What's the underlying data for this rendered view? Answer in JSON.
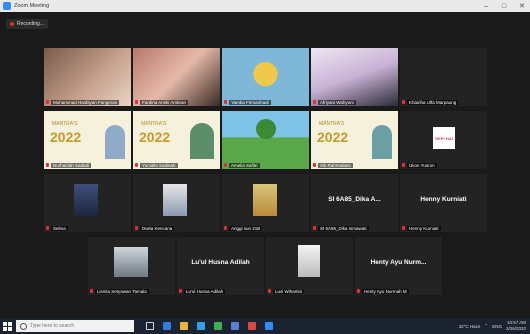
{
  "window": {
    "title": "Zoom Meeting",
    "minimize": "–",
    "maximize": "□",
    "close": "✕"
  },
  "recording": {
    "label": "Recording..."
  },
  "participants": [
    {
      "name": "Muhammad Hasbiyan Fangeran"
    },
    {
      "name": "Fardina Amiki Ambran"
    },
    {
      "name": "Yamba Firmanhadi"
    },
    {
      "name": "Afriyani Wahyuni"
    },
    {
      "name": "Khairiha Ulfa Marpaung"
    },
    {
      "name": "Nurhaidah Sadadi"
    },
    {
      "name": "Yunialla Sadinah"
    },
    {
      "name": "Amelia Safitri"
    },
    {
      "name": "Siti Rahmadani"
    },
    {
      "name": "Ukon Yusron"
    },
    {
      "name": "Selma"
    },
    {
      "name": "Dwita Kencana"
    },
    {
      "name": "Anggi sun 21B"
    },
    {
      "name": "SI 6A85_Dika Ismawati",
      "display": "SI 6A85_Dika A..."
    },
    {
      "name": "Henny Kurniati",
      "display": "Henny Kurniati"
    },
    {
      "name": "Lisnita Setyawan Tamala"
    },
    {
      "name": "Lu'ul Husna Adilah",
      "display": "Lu'ul Husna Adilah"
    },
    {
      "name": "Lusi Wihartini"
    },
    {
      "name": "Henty Ayu Nurmah M",
      "display": "Henty Ayu Nurm..."
    }
  ],
  "slides": {
    "banner_year": "2022",
    "banner_top": "MANTRA'S",
    "tagline": "HEP! HAI"
  },
  "taskbar": {
    "search_placeholder": "Type here to search",
    "weather": "32°C Haze",
    "time": "10:57 AM",
    "date": "2/26/2022",
    "lang": "ENG"
  }
}
